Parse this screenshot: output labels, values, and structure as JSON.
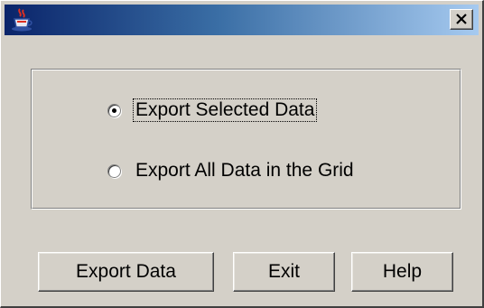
{
  "window": {
    "title": "",
    "app_icon": "java-coffee-cup-icon",
    "close_icon": "close-icon",
    "accent_color": "#0a246a",
    "face_color": "#d4d0c8"
  },
  "export_options": {
    "selected": "export_selected",
    "options": [
      {
        "id": "export_selected",
        "label": "Export Selected Data",
        "checked": true
      },
      {
        "id": "export_all",
        "label": "Export All Data in the Grid",
        "checked": false
      }
    ]
  },
  "buttons": {
    "export_label": "Export Data",
    "exit_label": "Exit",
    "help_label": "Help"
  }
}
